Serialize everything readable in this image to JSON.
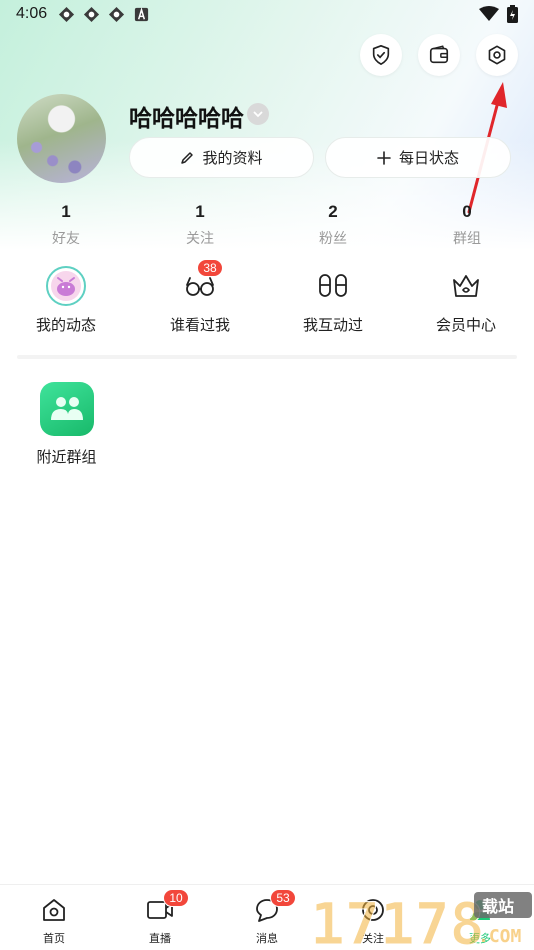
{
  "status_bar": {
    "time": "4:06",
    "notification_icons": [
      "app-notification-icon",
      "app-notification-icon",
      "app-notification-icon",
      "a-icon"
    ],
    "right_icons": [
      "wifi-icon",
      "battery-icon"
    ]
  },
  "top_actions": [
    "shield-check-icon",
    "wallet-icon",
    "settings-icon"
  ],
  "profile": {
    "username": "哈哈哈哈哈",
    "profile_button": "我的资料",
    "status_button": "每日状态"
  },
  "stats": [
    {
      "value": "1",
      "label": "好友"
    },
    {
      "value": "1",
      "label": "关注"
    },
    {
      "value": "2",
      "label": "粉丝"
    },
    {
      "value": "0",
      "label": "群组"
    }
  ],
  "features": [
    {
      "label": "我的动态",
      "icon": "avatar-sticker-icon"
    },
    {
      "label": "谁看过我",
      "icon": "glasses-icon",
      "badge": "38"
    },
    {
      "label": "我互动过",
      "icon": "footprints-icon"
    },
    {
      "label": "会员中心",
      "icon": "crown-icon"
    }
  ],
  "apps": [
    {
      "label": "附近群组",
      "icon": "group-people-icon"
    }
  ],
  "bottom_nav": [
    {
      "label": "首页",
      "icon": "home-icon"
    },
    {
      "label": "直播",
      "icon": "video-icon",
      "badge": "10"
    },
    {
      "label": "消息",
      "icon": "chat-icon",
      "badge": "53"
    },
    {
      "label": "关注",
      "icon": "follow-icon"
    },
    {
      "label": "更多",
      "icon": "profile-icon"
    }
  ],
  "watermark": {
    "big": "17178",
    "small_top": "载站",
    "small_bottom": ".COM"
  },
  "colors": {
    "accent": "#1dc978",
    "badge": "#f2473b",
    "annotation": "#e0262b"
  }
}
